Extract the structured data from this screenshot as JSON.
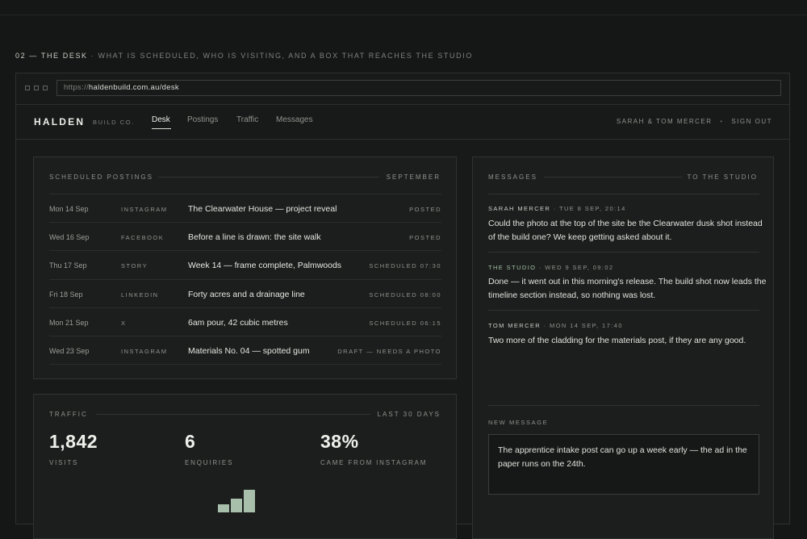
{
  "section": {
    "number": "02 — THE DESK",
    "subtitle": " · WHAT IS SCHEDULED, WHO IS VISITING, AND A BOX THAT REACHES THE STUDIO"
  },
  "browser": {
    "url_scheme": "https://",
    "url_host": "haldenbuild.com.au",
    "url_path": "/desk"
  },
  "nav": {
    "logo": "HALDEN",
    "logo_sub": "BUILD CO.",
    "tabs": [
      {
        "label": "Desk",
        "active": true
      },
      {
        "label": "Postings",
        "active": false
      },
      {
        "label": "Traffic",
        "active": false
      },
      {
        "label": "Messages",
        "active": false
      }
    ],
    "user": "SARAH & TOM MERCER",
    "separator": "•",
    "sign_out": "SIGN OUT"
  },
  "postings": {
    "title": "SCHEDULED POSTINGS",
    "month": "SEPTEMBER",
    "rows": [
      {
        "date": "Mon 14 Sep",
        "channel": "INSTAGRAM",
        "title": "The Clearwater House — project reveal",
        "status": "POSTED"
      },
      {
        "date": "Wed 16 Sep",
        "channel": "FACEBOOK",
        "title": "Before a line is drawn: the site walk",
        "status": "POSTED"
      },
      {
        "date": "Thu 17 Sep",
        "channel": "STORY",
        "title": "Week 14 — frame complete, Palmwoods",
        "status": "SCHEDULED 07:30"
      },
      {
        "date": "Fri 18 Sep",
        "channel": "LINKEDIN",
        "title": "Forty acres and a drainage line",
        "status": "SCHEDULED 08:00"
      },
      {
        "date": "Mon 21 Sep",
        "channel": "X",
        "title": "6am pour, 42 cubic metres",
        "status": "SCHEDULED 06:15"
      },
      {
        "date": "Wed 23 Sep",
        "channel": "INSTAGRAM",
        "title": "Materials No. 04 — spotted gum",
        "status": "DRAFT — NEEDS A PHOTO"
      }
    ]
  },
  "traffic": {
    "title": "TRAFFIC",
    "range": "LAST 30 DAYS",
    "stats": [
      {
        "value": "1,842",
        "label": "VISITS"
      },
      {
        "value": "6",
        "label": "ENQUIRIES"
      },
      {
        "value": "38%",
        "label": "CAME FROM INSTAGRAM"
      }
    ],
    "bar_color": "#a8c0ab",
    "bar_heights_fraction": [
      0.35,
      0.6,
      1.0
    ]
  },
  "messages": {
    "title": "MESSAGES",
    "to": "TO THE STUDIO",
    "items": [
      {
        "author": "SARAH MERCER",
        "time": " · TUE 8 SEP, 20:14",
        "body": "Could the photo at the top of the site be the Clearwater dusk shot instead of the build one? We keep getting asked about it."
      },
      {
        "author": "THE STUDIO",
        "time": " · WED 9 SEP, 09:02",
        "body": "Done — it went out in this morning's release. The build shot now leads the timeline section instead, so nothing was lost."
      },
      {
        "author": "TOM MERCER",
        "time": " · MON 14 SEP, 17:40",
        "body": "Two more of the cladding for the materials post, if they are any good."
      }
    ],
    "new_label": "NEW MESSAGE",
    "draft": "The apprentice intake post can go up a week early — the ad in the paper runs on the 24th."
  },
  "colors": {
    "background": "#151716",
    "panel": "#1c1e1d",
    "accent": "#a8c0ab",
    "studio": "#9fc0a4"
  }
}
